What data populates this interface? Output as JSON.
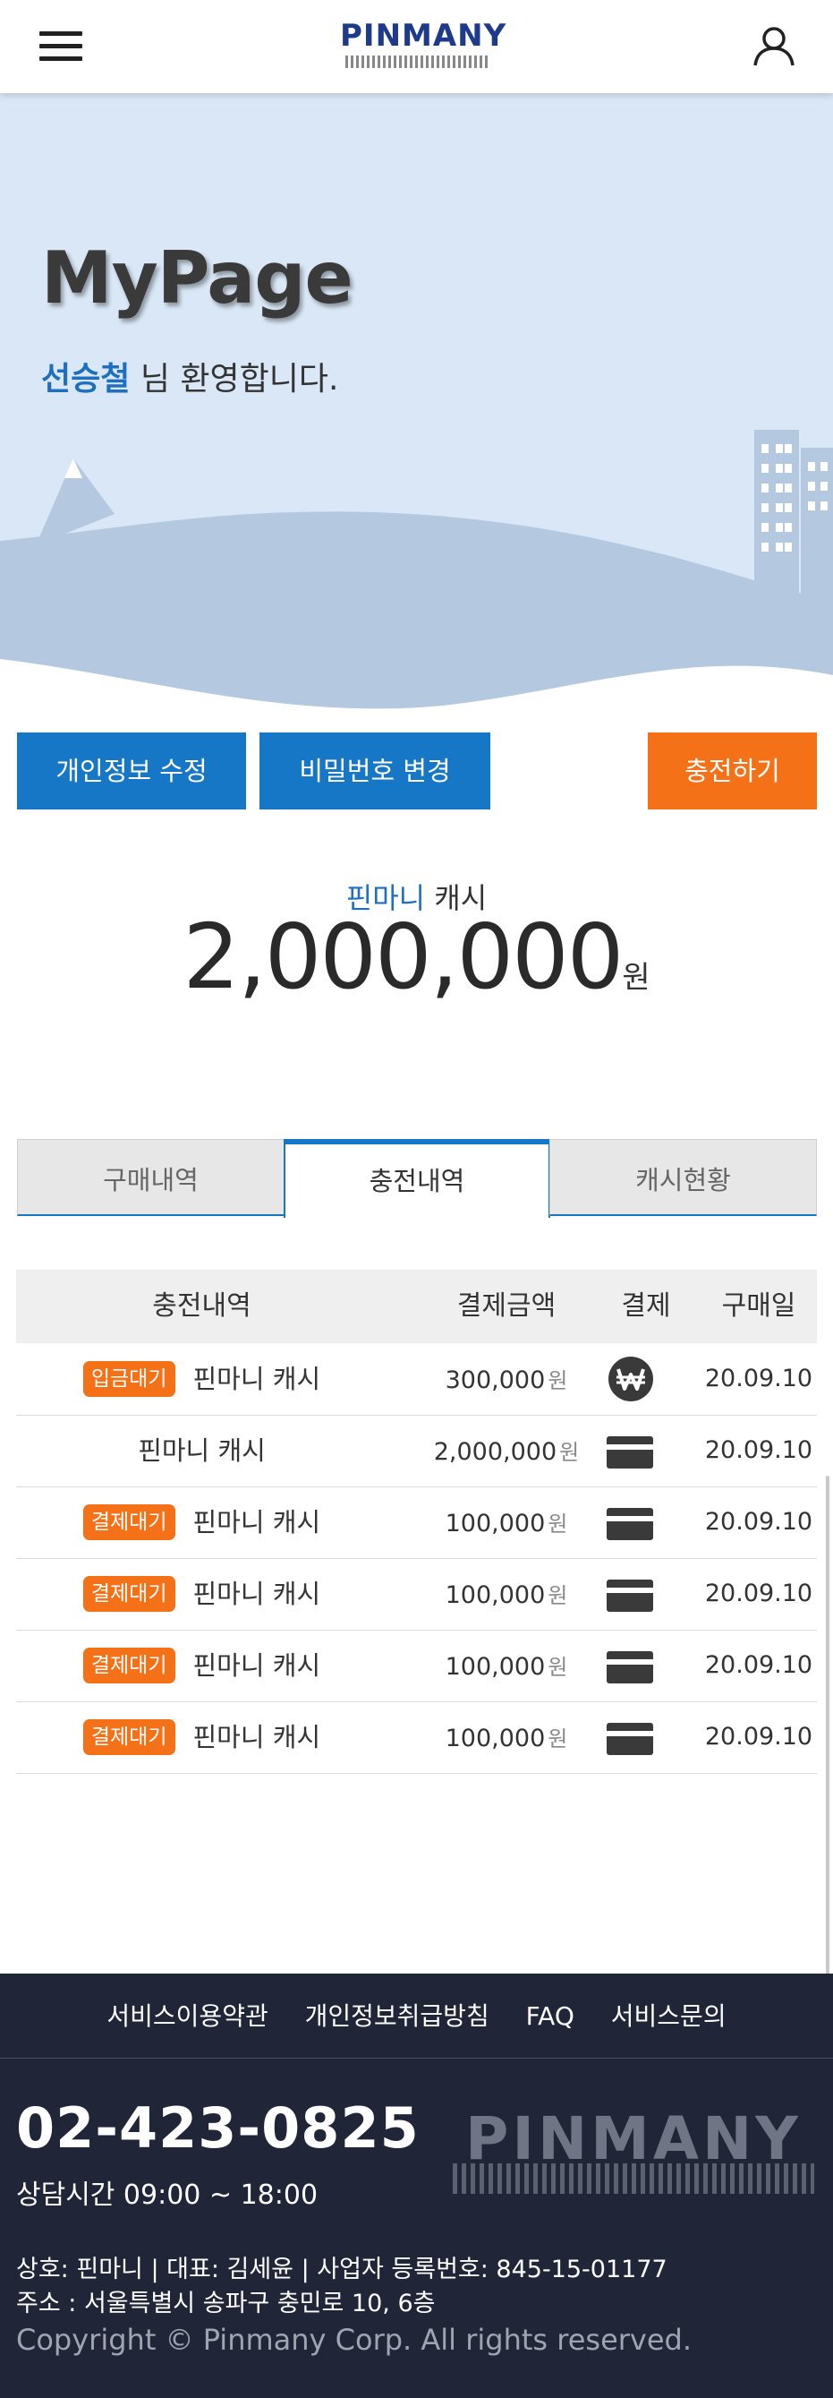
{
  "header": {
    "logo_text": "PINMANY"
  },
  "hero": {
    "title": "MyPage",
    "username": "선승철",
    "welcome_suffix": " 님 환영합니다."
  },
  "actions": {
    "edit_profile": "개인정보 수정",
    "change_password": "비밀번호 변경",
    "charge": "충전하기"
  },
  "cash": {
    "brand": "핀마니",
    "label": " 캐시",
    "amount": "2,000,000",
    "unit": "원"
  },
  "tabs": [
    {
      "label": "구매내역",
      "active": false
    },
    {
      "label": "충전내역",
      "active": true
    },
    {
      "label": "캐시현황",
      "active": false
    }
  ],
  "table": {
    "headers": [
      "충전내역",
      "결제금액",
      "결제",
      "구매일"
    ],
    "rows": [
      {
        "badge": "입금대기",
        "item": "핀마니 캐시",
        "amount": "300,000",
        "unit": "원",
        "payment": "won-coin-icon",
        "date": "20.09.10"
      },
      {
        "badge": "",
        "item": "핀마니 캐시",
        "amount": "2,000,000",
        "unit": "원",
        "payment": "credit-card-icon",
        "date": "20.09.10"
      },
      {
        "badge": "결제대기",
        "item": "핀마니 캐시",
        "amount": "100,000",
        "unit": "원",
        "payment": "credit-card-icon",
        "date": "20.09.10"
      },
      {
        "badge": "결제대기",
        "item": "핀마니 캐시",
        "amount": "100,000",
        "unit": "원",
        "payment": "credit-card-icon",
        "date": "20.09.10"
      },
      {
        "badge": "결제대기",
        "item": "핀마니 캐시",
        "amount": "100,000",
        "unit": "원",
        "payment": "credit-card-icon",
        "date": "20.09.10"
      },
      {
        "badge": "결제대기",
        "item": "핀마니 캐시",
        "amount": "100,000",
        "unit": "원",
        "payment": "credit-card-icon",
        "date": "20.09.10"
      }
    ]
  },
  "footer": {
    "links": [
      "서비스이용약관",
      "개인정보취급방침",
      "FAQ",
      "서비스문의"
    ],
    "phone": "02-423-0825",
    "hours": "상담시간 09:00 ~ 18:00",
    "logo_text": "PINMANY",
    "company": "상호: 핀마니 | 대표: 김세윤 | 사업자 등록번호: 845-15-01177",
    "address": "주소 : 서울특별시 송파구 충민로 10, 6층",
    "copyright": "Copyright © Pinmany Corp. All rights reserved."
  },
  "colors": {
    "primary_blue": "#1577c6",
    "accent_orange": "#f47118",
    "hero_bg": "#d9e7f6",
    "footer_bg": "#202537"
  }
}
